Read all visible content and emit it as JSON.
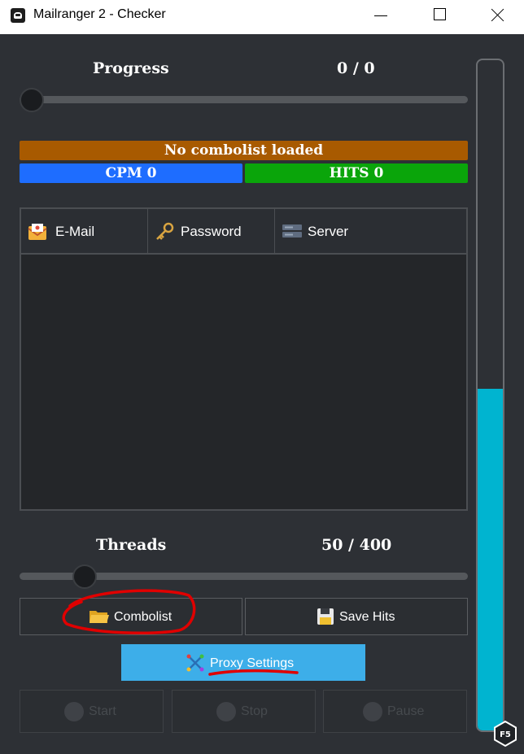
{
  "window": {
    "title": "Mailranger 2 - Checker"
  },
  "progress": {
    "label": "Progress",
    "value_text": "0 / 0",
    "fraction": 0.0
  },
  "status": {
    "combo_text": "No combolist loaded",
    "combo_color": "#a85a00",
    "cpm_text": "CPM 0",
    "cpm_color": "#1e6dff",
    "hits_text": "HITS 0",
    "hits_color": "#0aa50a"
  },
  "table": {
    "columns": [
      {
        "label": "E-Mail",
        "icon": "mail-icon"
      },
      {
        "label": "Password",
        "icon": "key-icon"
      },
      {
        "label": "Server",
        "icon": "server-icon"
      }
    ],
    "rows": []
  },
  "threads": {
    "label": "Threads",
    "value_text": "50 / 400",
    "current": 50,
    "max": 400
  },
  "buttons": {
    "combolist": "Combolist",
    "save_hits": "Save Hits",
    "proxy_settings": "Proxy Settings",
    "start": "Start",
    "stop": "Stop",
    "pause": "Pause"
  },
  "colors": {
    "accent": "#3daee9",
    "scroll_fill": "#00b4d0",
    "annotation": "#e00000"
  },
  "badge": {
    "text": "F5"
  }
}
